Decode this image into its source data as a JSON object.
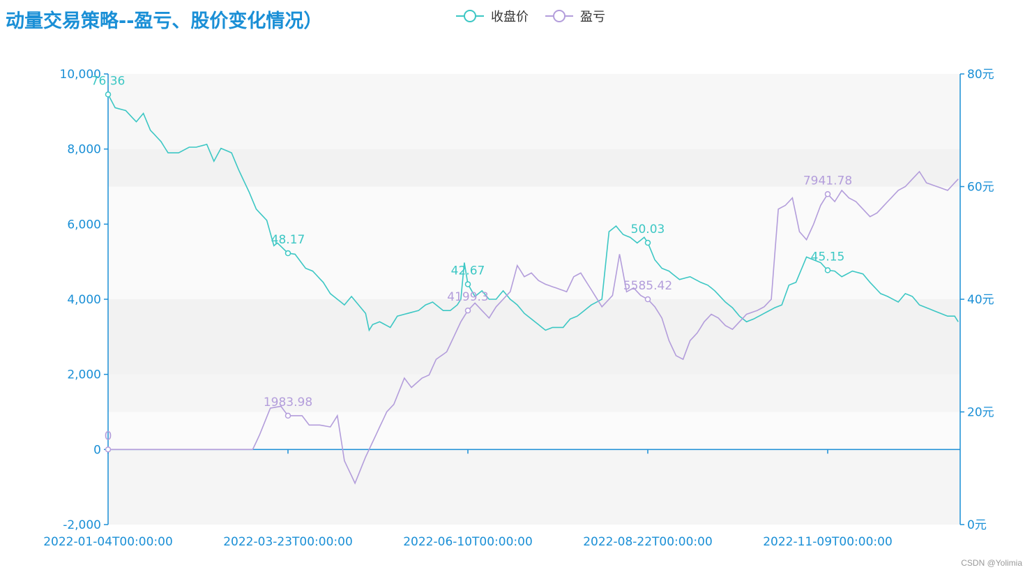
{
  "title": "动量交易策略--盈亏、股价变化情况）",
  "watermark": "CSDN @Yolimia",
  "colors": {
    "price": "#3cc7c4",
    "pnl": "#b39ddb",
    "axis": "#1a8fd6",
    "band": "#f2f2f2"
  },
  "chart_data": {
    "type": "line",
    "legend": [
      "收盘价",
      "盈亏"
    ],
    "x_ticks": [
      "2022-01-04T00:00:00",
      "2022-03-23T00:00:00",
      "2022-06-10T00:00:00",
      "2022-08-22T00:00:00",
      "2022-11-09T00:00:00"
    ],
    "x_count": 242,
    "x_tick_indices": [
      0,
      51,
      102,
      153,
      204
    ],
    "y_left": {
      "min": -2000,
      "max": 10000,
      "ticks": [
        "-2,000",
        "0",
        "2,000",
        "4,000",
        "6,000",
        "8,000",
        "10,000"
      ]
    },
    "y_right": {
      "min": 0,
      "max": 80,
      "ticks": [
        "0元",
        "20元",
        "40元",
        "60元",
        "80元"
      ]
    },
    "series": [
      {
        "name": "收盘价",
        "axis": "right",
        "keypoints": [
          [
            0,
            76.36
          ],
          [
            2,
            74
          ],
          [
            5,
            73.5
          ],
          [
            8,
            71.5
          ],
          [
            10,
            73
          ],
          [
            12,
            70
          ],
          [
            15,
            68
          ],
          [
            17,
            66
          ],
          [
            20,
            66
          ],
          [
            23,
            67
          ],
          [
            25,
            67
          ],
          [
            28,
            67.5
          ],
          [
            30,
            64.5
          ],
          [
            32,
            66.8
          ],
          [
            35,
            66
          ],
          [
            37,
            63
          ],
          [
            40,
            59
          ],
          [
            42,
            56
          ],
          [
            45,
            54
          ],
          [
            47,
            49.5
          ],
          [
            48,
            50
          ],
          [
            51,
            48.17
          ],
          [
            53,
            48
          ],
          [
            56,
            45.5
          ],
          [
            58,
            45
          ],
          [
            61,
            43
          ],
          [
            63,
            41
          ],
          [
            65,
            40
          ],
          [
            67,
            39
          ],
          [
            69,
            40.5
          ],
          [
            71,
            39
          ],
          [
            73,
            37.5
          ],
          [
            74,
            34.5
          ],
          [
            75,
            35.5
          ],
          [
            77,
            36
          ],
          [
            80,
            35
          ],
          [
            82,
            37
          ],
          [
            85,
            37.5
          ],
          [
            88,
            38
          ],
          [
            90,
            39
          ],
          [
            92,
            39.5
          ],
          [
            95,
            38
          ],
          [
            97,
            38
          ],
          [
            99,
            39
          ],
          [
            100,
            40
          ],
          [
            101,
            46.5
          ],
          [
            102,
            42.67
          ],
          [
            104,
            40.5
          ],
          [
            106,
            41.5
          ],
          [
            108,
            40
          ],
          [
            110,
            40
          ],
          [
            112,
            41.5
          ],
          [
            114,
            40
          ],
          [
            116,
            39
          ],
          [
            118,
            37.5
          ],
          [
            120,
            36.5
          ],
          [
            122,
            35.5
          ],
          [
            124,
            34.5
          ],
          [
            126,
            35
          ],
          [
            129,
            35
          ],
          [
            131,
            36.5
          ],
          [
            133,
            37
          ],
          [
            135,
            38
          ],
          [
            137,
            39
          ],
          [
            140,
            40
          ],
          [
            142,
            52
          ],
          [
            144,
            53
          ],
          [
            146,
            51.5
          ],
          [
            148,
            51
          ],
          [
            150,
            50
          ],
          [
            152,
            51
          ],
          [
            153,
            50.03
          ],
          [
            155,
            47
          ],
          [
            157,
            45.5
          ],
          [
            159,
            45
          ],
          [
            162,
            43.5
          ],
          [
            165,
            44
          ],
          [
            168,
            43
          ],
          [
            170,
            42.5
          ],
          [
            172,
            41.5
          ],
          [
            175,
            39.5
          ],
          [
            177,
            38.5
          ],
          [
            179,
            37
          ],
          [
            181,
            36
          ],
          [
            183,
            36.5
          ],
          [
            186,
            37.5
          ],
          [
            189,
            38.5
          ],
          [
            191,
            39
          ],
          [
            193,
            42.5
          ],
          [
            195,
            43
          ],
          [
            198,
            47.5
          ],
          [
            200,
            47
          ],
          [
            202,
            46.5
          ],
          [
            204,
            45.15
          ],
          [
            206,
            45
          ],
          [
            208,
            44
          ],
          [
            211,
            45
          ],
          [
            214,
            44.5
          ],
          [
            216,
            43
          ],
          [
            219,
            41
          ],
          [
            221,
            40.5
          ],
          [
            224,
            39.5
          ],
          [
            226,
            41
          ],
          [
            228,
            40.5
          ],
          [
            230,
            39
          ],
          [
            232,
            38.5
          ],
          [
            234,
            38
          ],
          [
            236,
            37.5
          ],
          [
            238,
            37
          ],
          [
            240,
            37
          ],
          [
            241,
            36
          ]
        ]
      },
      {
        "name": "盈亏",
        "axis": "left",
        "keypoints": [
          [
            0,
            0
          ],
          [
            41,
            0
          ],
          [
            43,
            400
          ],
          [
            46,
            1100
          ],
          [
            49,
            1150
          ],
          [
            51,
            900
          ],
          [
            55,
            900
          ],
          [
            57,
            650
          ],
          [
            60,
            650
          ],
          [
            63,
            600
          ],
          [
            65,
            900
          ],
          [
            67,
            -300
          ],
          [
            70,
            -900
          ],
          [
            73,
            -200
          ],
          [
            75,
            200
          ],
          [
            77,
            600
          ],
          [
            79,
            1000
          ],
          [
            81,
            1200
          ],
          [
            84,
            1900
          ],
          [
            86,
            1650
          ],
          [
            89,
            1900
          ],
          [
            91,
            1983.98
          ],
          [
            93,
            2400
          ],
          [
            96,
            2600
          ],
          [
            98,
            3000
          ],
          [
            100,
            3400
          ],
          [
            102,
            3700
          ],
          [
            104,
            3900
          ],
          [
            106,
            3700
          ],
          [
            108,
            3500
          ],
          [
            110,
            3800
          ],
          [
            112,
            4000
          ],
          [
            114,
            4200
          ],
          [
            116,
            4900
          ],
          [
            118,
            4600
          ],
          [
            120,
            4700
          ],
          [
            122,
            4500
          ],
          [
            124,
            4400
          ],
          [
            127,
            4300
          ],
          [
            130,
            4200
          ],
          [
            132,
            4600
          ],
          [
            134,
            4700
          ],
          [
            136,
            4400
          ],
          [
            138,
            4100
          ],
          [
            140,
            3800
          ],
          [
            143,
            4100
          ],
          [
            145,
            5200
          ],
          [
            147,
            4199.3
          ],
          [
            149,
            4300
          ],
          [
            151,
            4100
          ],
          [
            153,
            4000
          ],
          [
            155,
            3800
          ],
          [
            157,
            3500
          ],
          [
            159,
            2900
          ],
          [
            161,
            2500
          ],
          [
            163,
            2400
          ],
          [
            165,
            2900
          ],
          [
            167,
            3100
          ],
          [
            169,
            3400
          ],
          [
            171,
            3600
          ],
          [
            173,
            3500
          ],
          [
            175,
            3300
          ],
          [
            177,
            3200
          ],
          [
            179,
            3400
          ],
          [
            181,
            3600
          ],
          [
            184,
            3700
          ],
          [
            186,
            3800
          ],
          [
            188,
            4000
          ],
          [
            190,
            6400
          ],
          [
            192,
            6500
          ],
          [
            194,
            6700
          ],
          [
            196,
            5800
          ],
          [
            198,
            5585.42
          ],
          [
            200,
            6000
          ],
          [
            202,
            6500
          ],
          [
            204,
            6800
          ],
          [
            206,
            6600
          ],
          [
            208,
            6900
          ],
          [
            210,
            6700
          ],
          [
            212,
            6600
          ],
          [
            214,
            6400
          ],
          [
            216,
            6200
          ],
          [
            218,
            6300
          ],
          [
            220,
            6500
          ],
          [
            222,
            6700
          ],
          [
            224,
            6900
          ],
          [
            226,
            7000
          ],
          [
            228,
            7200
          ],
          [
            230,
            7400
          ],
          [
            232,
            7100
          ],
          [
            235,
            7000
          ],
          [
            238,
            6900
          ],
          [
            241,
            7200
          ],
          [
            243,
            7500
          ],
          [
            245,
            7941.78
          ],
          [
            247,
            8100
          ],
          [
            249,
            7900
          ],
          [
            251,
            7500
          ],
          [
            253,
            7200
          ],
          [
            256,
            7400
          ],
          [
            258,
            7700
          ],
          [
            260,
            7900
          ],
          [
            262,
            8000
          ],
          [
            264,
            8100
          ],
          [
            266,
            8000
          ],
          [
            268,
            7900
          ],
          [
            271,
            7900
          ],
          [
            273,
            8000
          ],
          [
            276,
            8000
          ],
          [
            279,
            8100
          ]
        ]
      }
    ],
    "labels": [
      {
        "series": "收盘价",
        "index": 0,
        "text": "76.36"
      },
      {
        "series": "收盘价",
        "index": 51,
        "text": "48.17"
      },
      {
        "series": "收盘价",
        "index": 102,
        "text": "42.67"
      },
      {
        "series": "收盘价",
        "index": 153,
        "text": "50.03"
      },
      {
        "series": "收盘价",
        "index": 204,
        "text": "45.15"
      },
      {
        "series": "盈亏",
        "index": 0,
        "text": "0"
      },
      {
        "series": "盈亏",
        "index": 51,
        "text": "1983.98"
      },
      {
        "series": "盈亏",
        "index": 102,
        "text": "4199.3"
      },
      {
        "series": "盈亏",
        "index": 153,
        "text": "5585.42"
      },
      {
        "series": "盈亏",
        "index": 204,
        "text": "7941.78"
      }
    ]
  }
}
